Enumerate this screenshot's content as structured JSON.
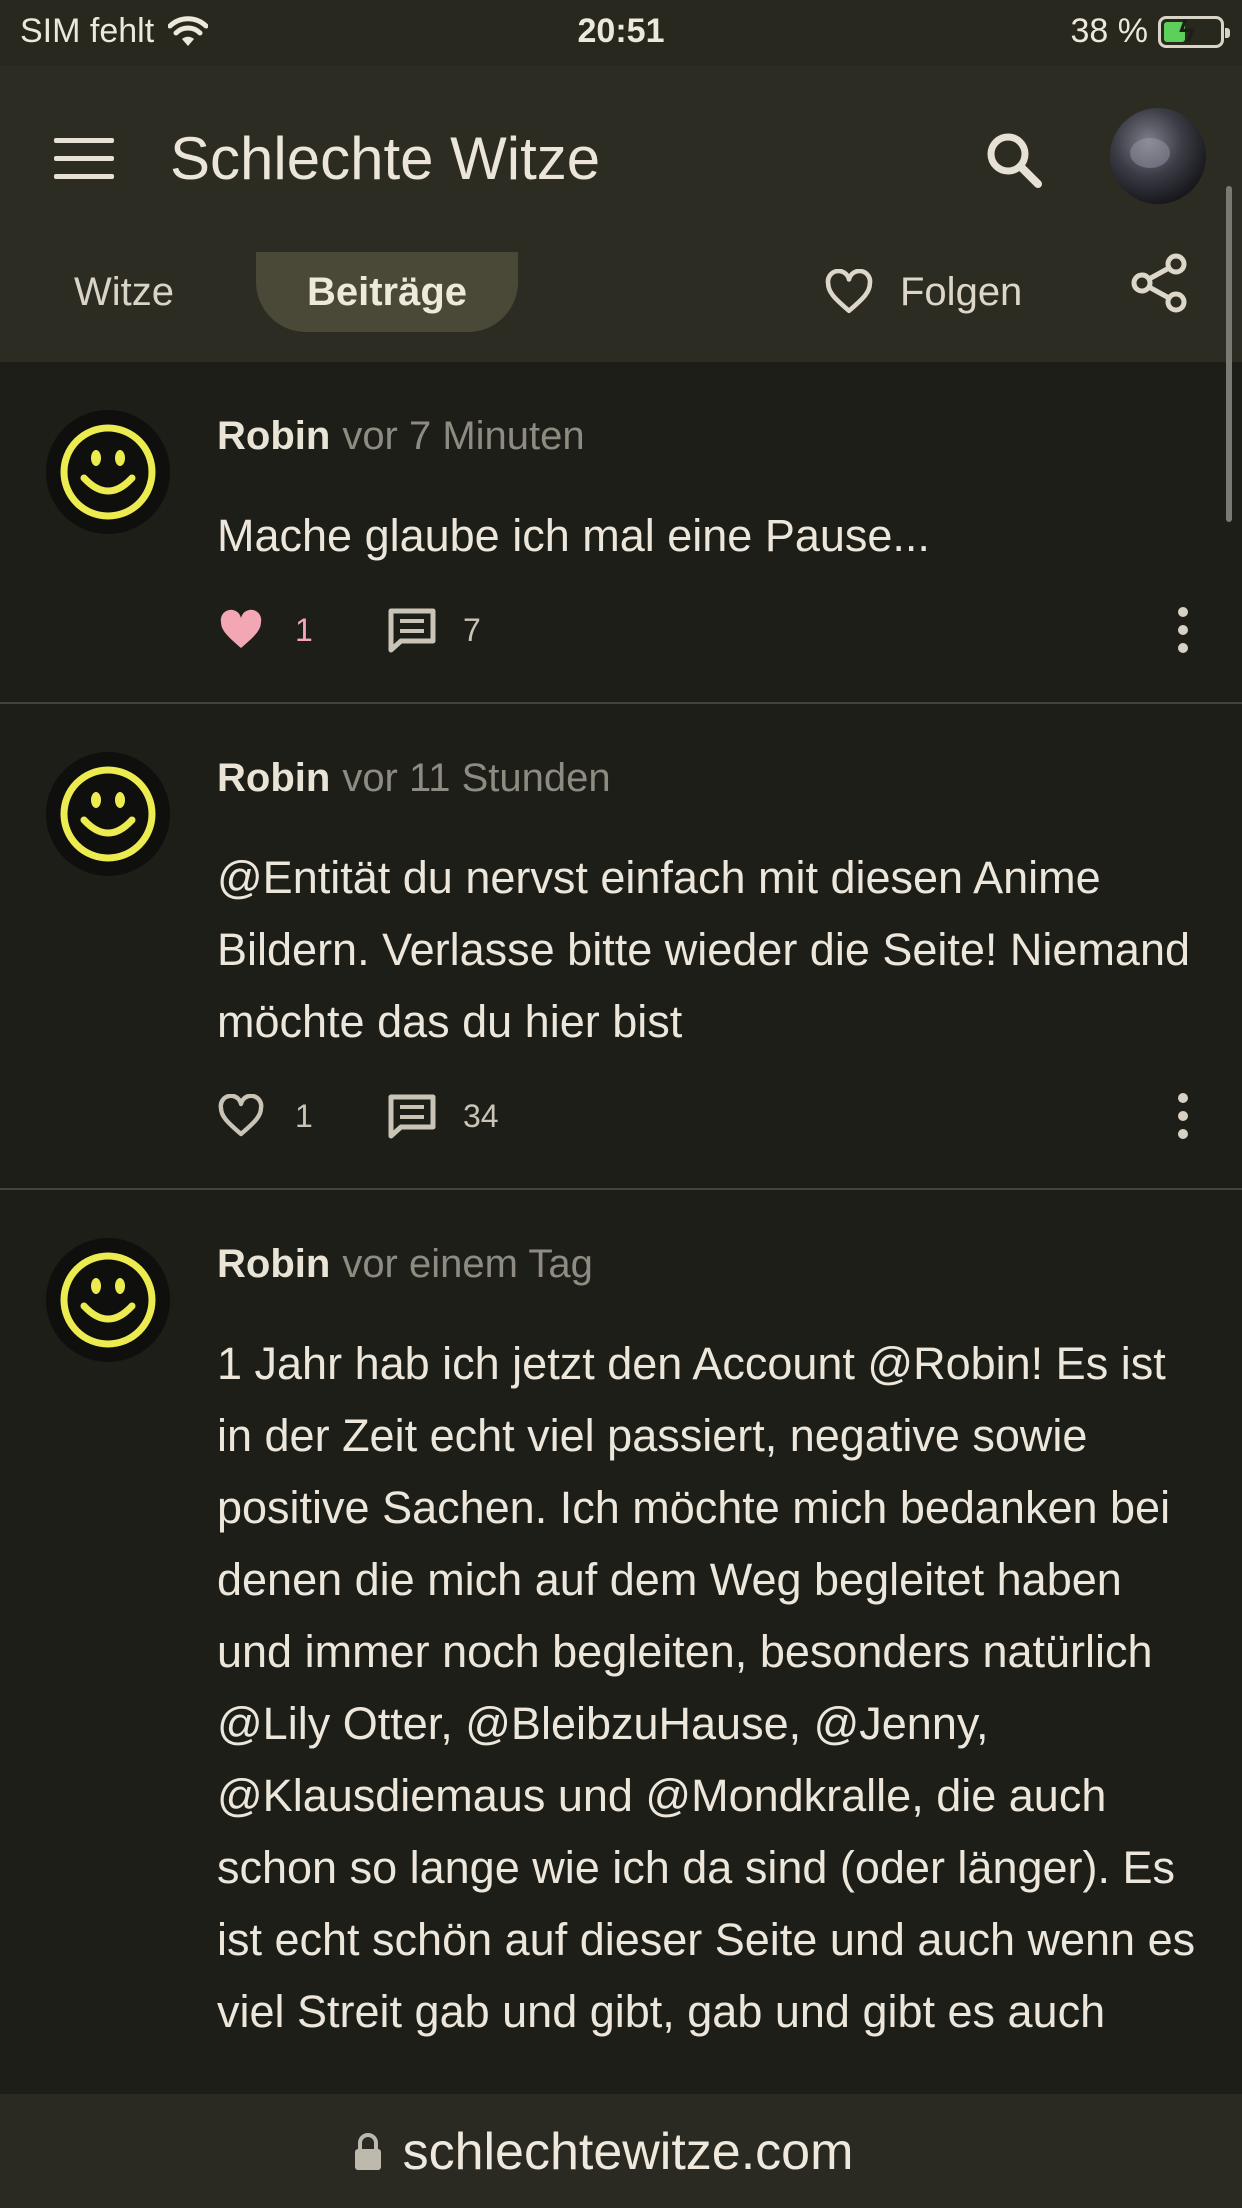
{
  "status_bar": {
    "carrier": "SIM fehlt",
    "time": "20:51",
    "battery": "38 %",
    "battery_level": 0.38
  },
  "app_bar": {
    "title": "Schlechte Witze",
    "tabs": [
      {
        "label": "Witze",
        "active": false
      },
      {
        "label": "Beiträge",
        "active": true
      }
    ],
    "follow_label": "Folgen"
  },
  "posts": [
    {
      "author": "Robin",
      "time": "vor 7 Minuten",
      "text": "Mache glaube ich mal eine Pause...",
      "likes": "1",
      "liked": true,
      "comments": "7"
    },
    {
      "author": "Robin",
      "time": "vor 11 Stunden",
      "text": "@Entität du nervst einfach mit diesen Anime Bildern. Verlasse bitte wieder die Seite! Niemand möchte das du hier bist",
      "likes": "1",
      "liked": false,
      "comments": "34"
    },
    {
      "author": "Robin",
      "time": "vor einem Tag",
      "text": "1 Jahr hab ich jetzt den Account @Robin! Es ist in der Zeit echt viel passiert, negative sowie positive Sachen. Ich möchte mich bedanken bei denen die mich auf dem Weg begleitet haben und immer noch begleiten, besonders natürlich @Lily Otter, @BleibzuHause, @Jenny, @Klausdiemaus und @Mondkralle, die auch schon so lange wie ich da sind (oder länger). Es ist echt schön auf dieser Seite und auch wenn es viel Streit gab und gibt, gab und gibt es auch"
    }
  ],
  "url_bar": {
    "url": "schlechtewitze.com"
  },
  "colors": {
    "background": "#1e1e19",
    "app_bar": "#2d2c22",
    "active_tab": "#4a4836",
    "like_active": "#f3a7b5",
    "smiley_yellow": "#ecec50"
  }
}
